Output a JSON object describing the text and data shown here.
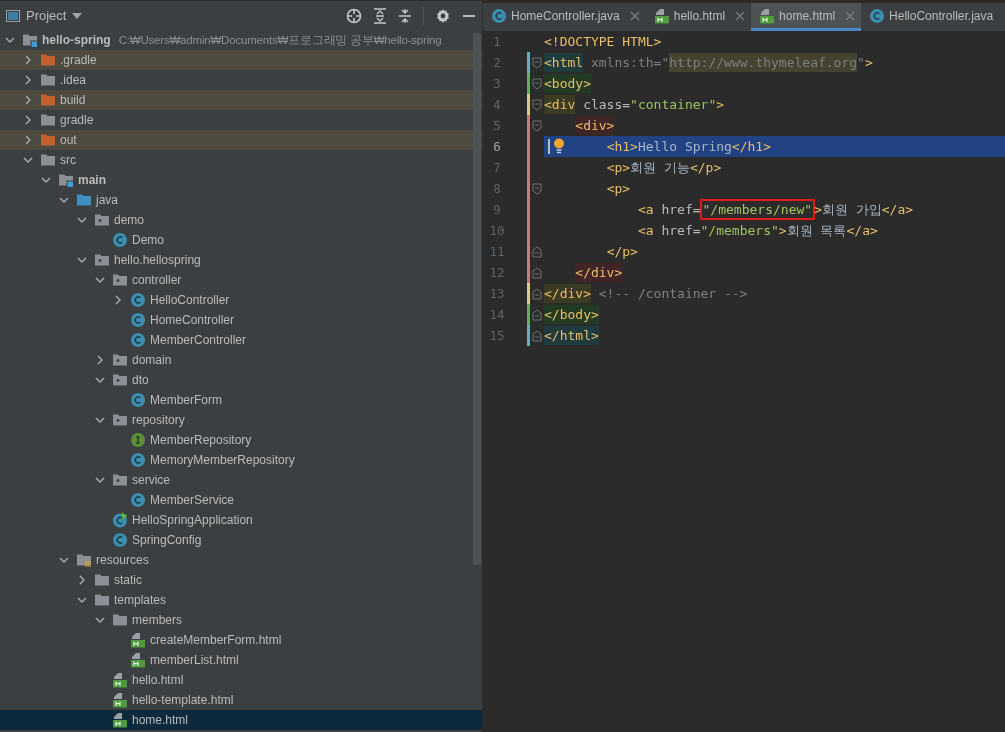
{
  "project_panel": {
    "title": "Project",
    "tree": [
      {
        "label": "hello-spring",
        "path": "C:₩Users₩admin₩Documents₩프로그래밍 공부₩hello-spring",
        "kind": "module",
        "expanded": true,
        "selected": false,
        "children": [
          {
            "label": ".gradle",
            "kind": "excluded",
            "expanded": false,
            "selected": false
          },
          {
            "label": ".idea",
            "kind": "folder",
            "expanded": false,
            "selected": false
          },
          {
            "label": "build",
            "kind": "excluded",
            "expanded": false,
            "selected": false
          },
          {
            "label": "gradle",
            "kind": "folder",
            "expanded": false,
            "selected": false
          },
          {
            "label": "out",
            "kind": "excluded",
            "expanded": false,
            "selected": false
          },
          {
            "label": "src",
            "kind": "folder",
            "expanded": true,
            "selected": false,
            "children": [
              {
                "label": "main",
                "kind": "module",
                "expanded": true,
                "selected": false,
                "children": [
                  {
                    "label": "java",
                    "kind": "source",
                    "expanded": true,
                    "selected": false,
                    "children": [
                      {
                        "label": "demo",
                        "kind": "package",
                        "expanded": true,
                        "selected": false,
                        "children": [
                          {
                            "label": "Demo",
                            "kind": "class",
                            "selected": false
                          }
                        ]
                      },
                      {
                        "label": "hello.hellospring",
                        "kind": "package",
                        "expanded": true,
                        "selected": false,
                        "children": [
                          {
                            "label": "controller",
                            "kind": "package",
                            "expanded": true,
                            "selected": false,
                            "children": [
                              {
                                "label": "HelloController",
                                "kind": "class",
                                "expanded": false,
                                "selected": false
                              },
                              {
                                "label": "HomeController",
                                "kind": "class",
                                "selected": false
                              },
                              {
                                "label": "MemberController",
                                "kind": "class",
                                "selected": false
                              }
                            ]
                          },
                          {
                            "label": "domain",
                            "kind": "package",
                            "expanded": false,
                            "selected": false
                          },
                          {
                            "label": "dto",
                            "kind": "package",
                            "expanded": true,
                            "selected": false,
                            "children": [
                              {
                                "label": "MemberForm",
                                "kind": "class",
                                "selected": false
                              }
                            ]
                          },
                          {
                            "label": "repository",
                            "kind": "package",
                            "expanded": true,
                            "selected": false,
                            "children": [
                              {
                                "label": "MemberRepository",
                                "kind": "interface",
                                "selected": false
                              },
                              {
                                "label": "MemoryMemberRepository",
                                "kind": "class",
                                "selected": false
                              }
                            ]
                          },
                          {
                            "label": "service",
                            "kind": "package",
                            "expanded": true,
                            "selected": false,
                            "children": [
                              {
                                "label": "MemberService",
                                "kind": "class",
                                "selected": false
                              }
                            ]
                          },
                          {
                            "label": "HelloSpringApplication",
                            "kind": "application",
                            "selected": false
                          },
                          {
                            "label": "SpringConfig",
                            "kind": "class",
                            "selected": false
                          }
                        ]
                      }
                    ]
                  },
                  {
                    "label": "resources",
                    "kind": "resources",
                    "expanded": true,
                    "selected": false,
                    "children": [
                      {
                        "label": "static",
                        "kind": "folder",
                        "expanded": false,
                        "selected": false
                      },
                      {
                        "label": "templates",
                        "kind": "folder",
                        "expanded": true,
                        "selected": false,
                        "children": [
                          {
                            "label": "members",
                            "kind": "folder",
                            "expanded": true,
                            "selected": false,
                            "children": [
                              {
                                "label": "createMemberForm.html",
                                "kind": "html",
                                "selected": false
                              },
                              {
                                "label": "memberList.html",
                                "kind": "html",
                                "selected": false
                              }
                            ]
                          },
                          {
                            "label": "hello.html",
                            "kind": "html",
                            "selected": false
                          },
                          {
                            "label": "hello-template.html",
                            "kind": "html",
                            "selected": false
                          },
                          {
                            "label": "home.html",
                            "kind": "html",
                            "selected": true
                          }
                        ]
                      }
                    ]
                  }
                ]
              }
            ]
          }
        ]
      }
    ]
  },
  "tabs": [
    {
      "label": "HomeController.java",
      "kind": "class",
      "selected": false,
      "closable": true
    },
    {
      "label": "hello.html",
      "kind": "html",
      "selected": false,
      "closable": true
    },
    {
      "label": "home.html",
      "kind": "html",
      "selected": true,
      "closable": true
    },
    {
      "label": "HelloController.java",
      "kind": "class",
      "selected": false,
      "closable": false
    }
  ],
  "editor": {
    "lines": [
      {
        "number": "1",
        "current": false,
        "tokens": [
          {
            "kind": "tag",
            "text": "<!DOCTYPE HTML>"
          }
        ]
      },
      {
        "number": "2",
        "current": false,
        "color": "#5fb3b8",
        "fold_start": true,
        "tokens": [
          {
            "kind": "tag",
            "text": "<html",
            "color": "#1f3b3d"
          },
          {
            "kind": "unused",
            "text": " xmlns:th=\""
          },
          {
            "kind": "url",
            "text": "http://www.thymeleaf.org",
            "color": "#45432f"
          },
          {
            "kind": "unused",
            "text": "\""
          },
          {
            "kind": "tag",
            "text": ">"
          }
        ]
      },
      {
        "number": "3",
        "current": false,
        "color": "#5fae62",
        "fold_start": true,
        "tokens": [
          {
            "kind": "tag",
            "text": "<body>",
            "color": "#223b22"
          }
        ]
      },
      {
        "number": "4",
        "current": false,
        "color": "#d3cf7a",
        "fold_start": true,
        "tokens": [
          {
            "kind": "tag",
            "text": "<div",
            "color": "#3b3a22"
          },
          {
            "kind": "attr",
            "text": " class="
          },
          {
            "kind": "value",
            "text": "\"container\""
          },
          {
            "kind": "tag",
            "text": ">"
          }
        ]
      },
      {
        "number": "5",
        "current": false,
        "color": "#c77a7a",
        "fold_start": true,
        "tokens": [
          {
            "kind": "tag",
            "text": "    <div>",
            "color": "#402426"
          }
        ]
      },
      {
        "number": "6",
        "current": true,
        "color": "#c77a7a",
        "tokens": [
          {
            "kind": "tag",
            "text": "        <h1>"
          },
          {
            "kind": "text",
            "text": "Hello Spring"
          },
          {
            "kind": "tag",
            "text": "</h1>"
          }
        ]
      },
      {
        "number": "7",
        "current": false,
        "color": "#c77a7a",
        "tokens": [
          {
            "kind": "tag",
            "text": "        <p>"
          },
          {
            "kind": "text",
            "text": "회원 기능"
          },
          {
            "kind": "tag",
            "text": "</p>"
          }
        ]
      },
      {
        "number": "8",
        "current": false,
        "color": "#c77a7a",
        "fold_start": true,
        "tokens": [
          {
            "kind": "tag",
            "text": "        <p>"
          }
        ]
      },
      {
        "number": "9",
        "current": false,
        "color": "#c77a7a",
        "tokens": [
          {
            "kind": "tag",
            "text": "            <a"
          },
          {
            "kind": "attr",
            "text": " href="
          },
          {
            "kind": "value",
            "text": "\"/members/new\"",
            "boxed": true
          },
          {
            "kind": "tag",
            "text": ">"
          },
          {
            "kind": "text",
            "text": "회원 가입"
          },
          {
            "kind": "tag",
            "text": "</a>"
          }
        ]
      },
      {
        "number": "10",
        "current": false,
        "color": "#c77a7a",
        "tokens": [
          {
            "kind": "tag",
            "text": "            <a"
          },
          {
            "kind": "attr",
            "text": " href="
          },
          {
            "kind": "value",
            "text": "\"/members\""
          },
          {
            "kind": "tag",
            "text": ">"
          },
          {
            "kind": "text",
            "text": "회원 목록"
          },
          {
            "kind": "tag",
            "text": "</a>"
          }
        ]
      },
      {
        "number": "11",
        "current": false,
        "color": "#c77a7a",
        "fold_end": true,
        "tokens": [
          {
            "kind": "tag",
            "text": "        </p>"
          }
        ]
      },
      {
        "number": "12",
        "current": false,
        "color": "#c77a7a",
        "fold_end": true,
        "tokens": [
          {
            "kind": "tag",
            "text": "    </div>",
            "color": "#402426"
          }
        ]
      },
      {
        "number": "13",
        "current": false,
        "color": "#d3cf7a",
        "fold_end": true,
        "tokens": [
          {
            "kind": "tag",
            "text": "</div>",
            "color": "#3b3a22"
          },
          {
            "kind": "comment",
            "text": " <!-- /container -->"
          }
        ]
      },
      {
        "number": "14",
        "current": false,
        "color": "#5fae62",
        "fold_end": true,
        "tokens": [
          {
            "kind": "tag",
            "text": "</body>",
            "color": "#223b22"
          }
        ]
      },
      {
        "number": "15",
        "current": false,
        "color": "#5fb3b8",
        "fold_end": true,
        "tokens": [
          {
            "kind": "tag",
            "text": "</html>",
            "color": "#1f3b3d"
          }
        ]
      }
    ]
  }
}
